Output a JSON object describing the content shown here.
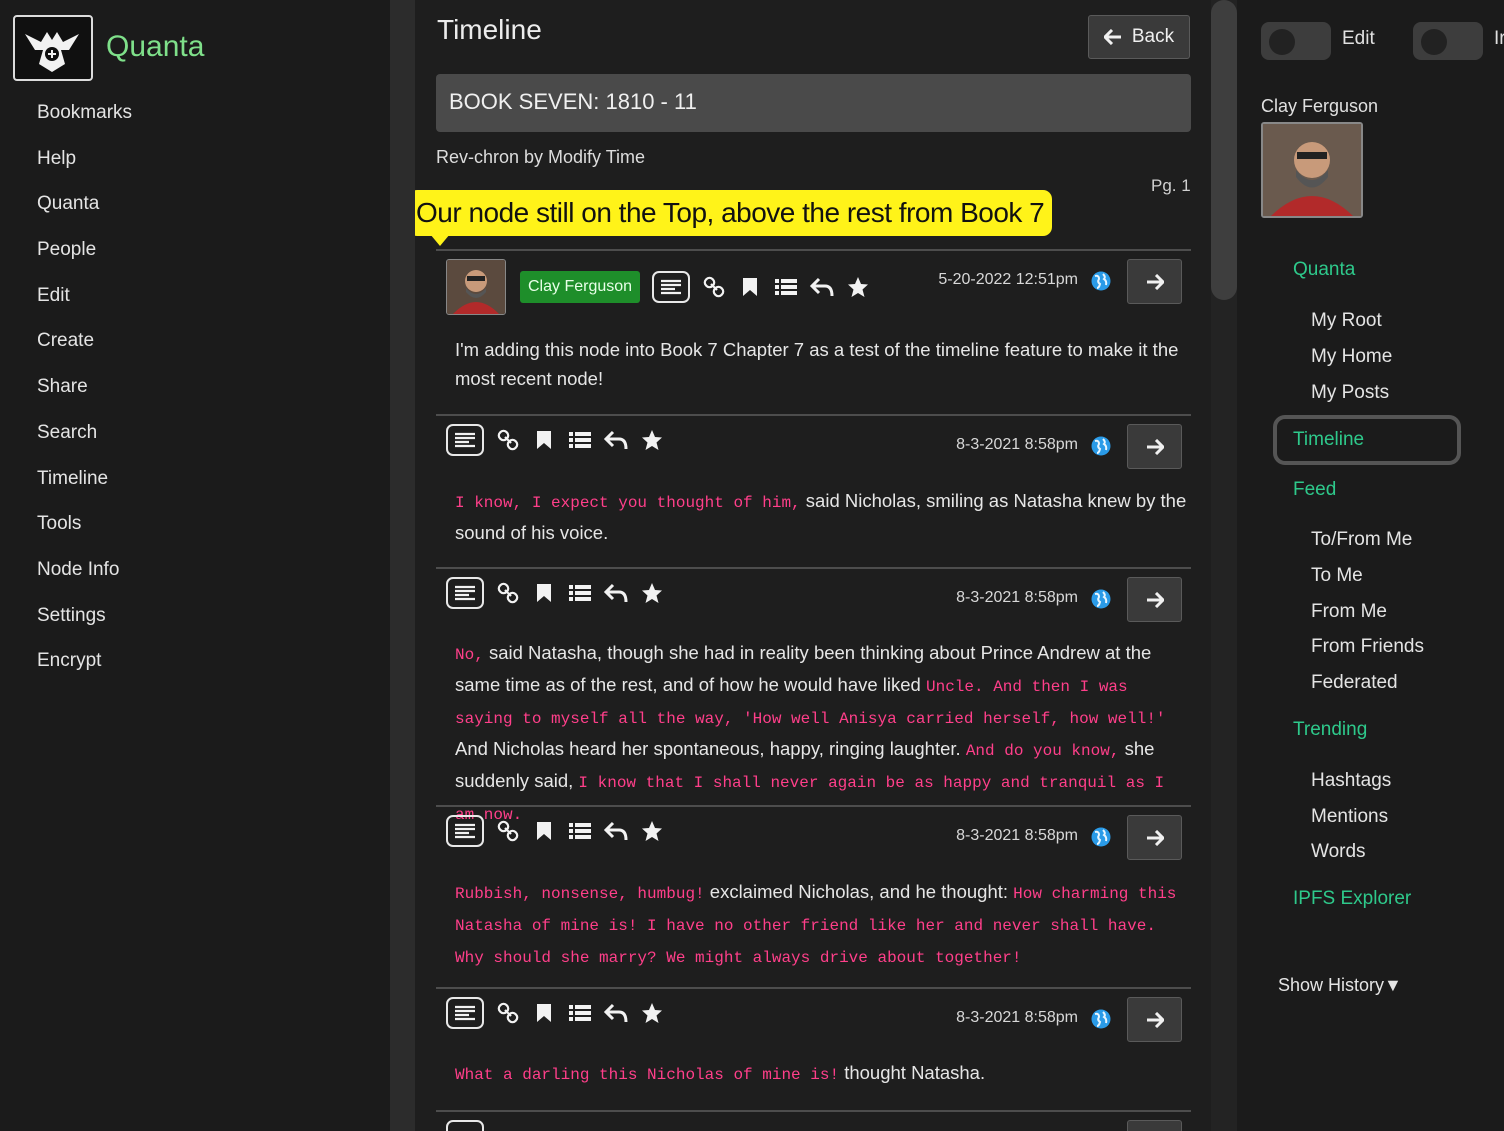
{
  "app": {
    "name": "Quanta"
  },
  "left_menu": [
    "Bookmarks",
    "Help",
    "Quanta",
    "People",
    "Edit",
    "Create",
    "Share",
    "Search",
    "Timeline",
    "Tools",
    "Node Info",
    "Settings",
    "Encrypt"
  ],
  "main": {
    "title": "Timeline",
    "back_label": "Back",
    "book_title": "BOOK SEVEN: 1810 - 11",
    "sort_label": "Rev-chron by Modify Time",
    "page_label": "Pg. 1",
    "callout": "Our node still on the Top, above the rest from Book 7"
  },
  "nodes": [
    {
      "owner": "Clay Ferguson",
      "timestamp": "5-20-2022 12:51pm",
      "text": "I'm adding this node into Book 7 Chapter 7 as a test of the timeline feature to make it the most recent node!"
    },
    {
      "timestamp": "8-3-2021 8:58pm",
      "q1": "I know, I expect you thought of him,",
      "t1": " said Nicholas, smiling as Natasha knew by the sound of his voice."
    },
    {
      "timestamp": "8-3-2021 8:58pm",
      "q1": "No,",
      "t1": " said Natasha, though she had in reality been thinking about Prince Andrew at the same time as of the rest, and of how he would have liked ",
      "q2": "Uncle. And then I was saying to myself all the way, 'How well Anisya carried herself, how well!'",
      "t2": " And Nicholas heard her spontaneous, happy, ringing laughter. ",
      "q3": "And do you know,",
      "t3": " she suddenly said, ",
      "q4": "I know that I shall never again be as happy and tranquil as I am now."
    },
    {
      "timestamp": "8-3-2021 8:58pm",
      "q1": "Rubbish, nonsense, humbug!",
      "t1": " exclaimed Nicholas, and he thought: ",
      "q2": "How charming this Natasha of mine is! I have no other friend like her and never shall have. Why should she marry? We might always drive about together!"
    },
    {
      "timestamp": "8-3-2021 8:58pm",
      "q1": "What a darling this Nicholas of mine is!",
      "t1": " thought Natasha."
    }
  ],
  "right": {
    "toggle_edit_label": "Edit",
    "toggle_info_label": "Ir",
    "user_name": "Clay Ferguson",
    "nav": {
      "quanta": "Quanta",
      "my_root": "My Root",
      "my_home": "My Home",
      "my_posts": "My Posts",
      "timeline": "Timeline",
      "feed": "Feed",
      "to_from_me": "To/From Me",
      "to_me": "To Me",
      "from_me": "From Me",
      "from_friends": "From Friends",
      "federated": "Federated",
      "trending": "Trending",
      "hashtags": "Hashtags",
      "mentions": "Mentions",
      "words": "Words",
      "ipfs_explorer": "IPFS Explorer"
    },
    "show_history": "Show History▼"
  },
  "colors": {
    "accent_green": "#2ec98b",
    "quote_pink": "#ff3f8a",
    "callout_yellow": "#fff319",
    "owner_badge": "#1e8e2a"
  }
}
